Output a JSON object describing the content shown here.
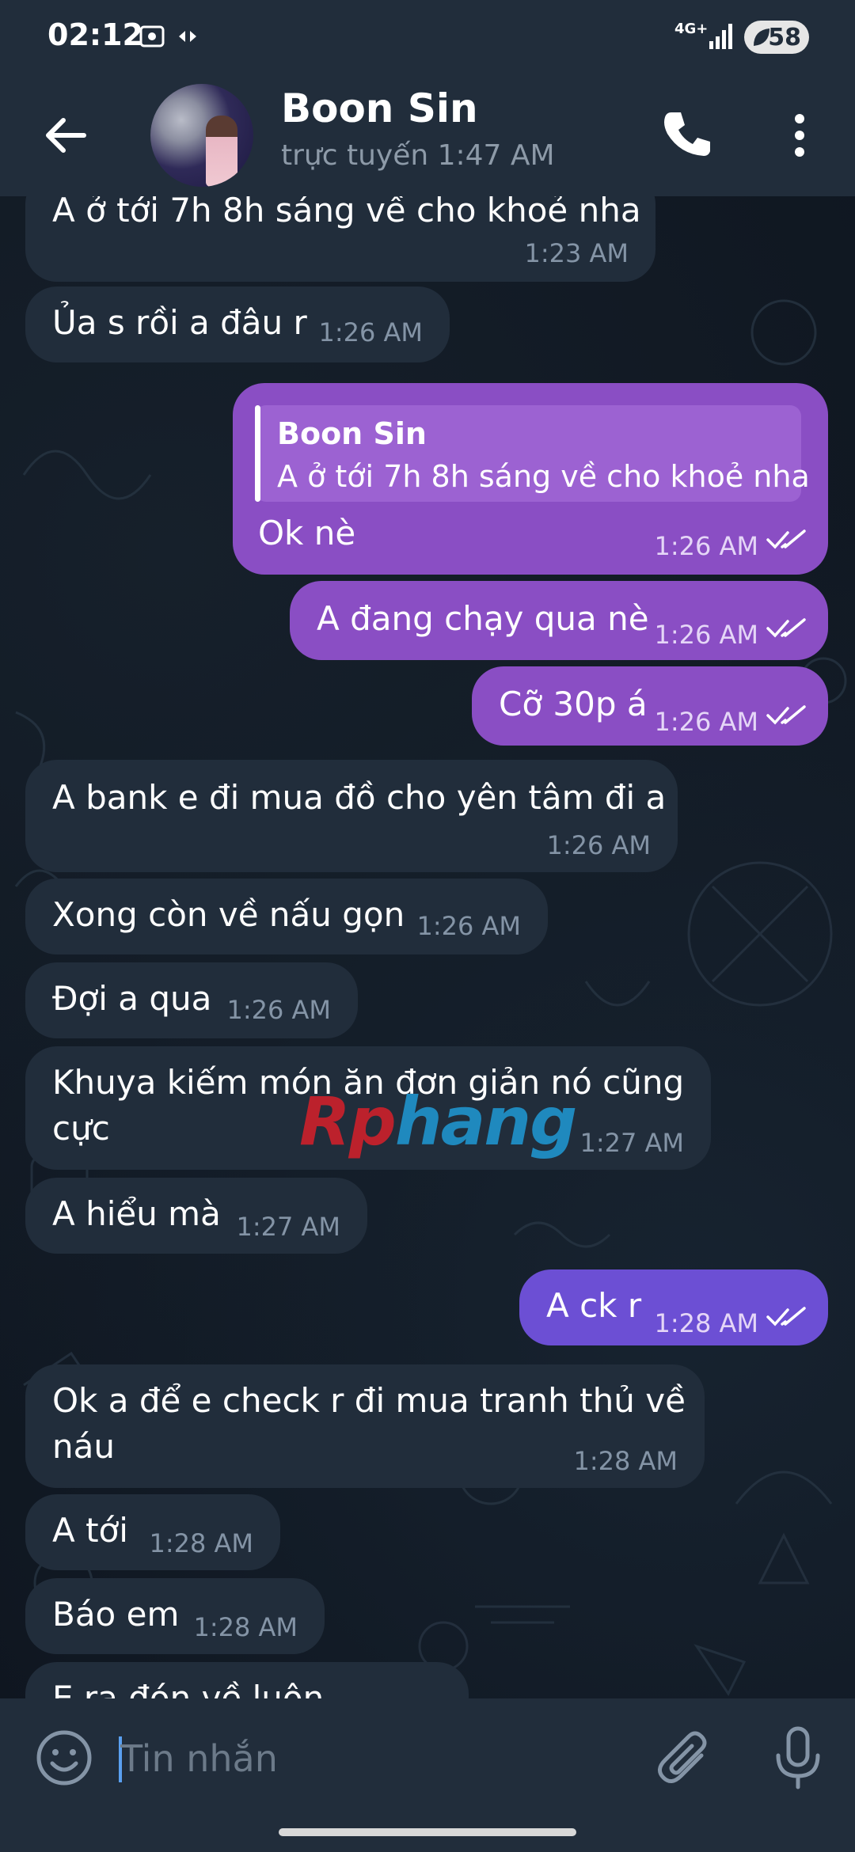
{
  "status_bar": {
    "time": "02:12",
    "network": "4G+",
    "battery": "58"
  },
  "header": {
    "contact_name": "Boon Sin",
    "contact_status": "trực tuyến 1:47 AM"
  },
  "messages": [
    {
      "direction": "in",
      "text": "A ở tới 7h 8h sáng về cho khoẻ nha",
      "time": "1:23 AM"
    },
    {
      "direction": "in",
      "text": "Ủa s rồi a đâu r",
      "time": "1:26 AM"
    },
    {
      "direction": "out",
      "reply_to_name": "Boon Sin",
      "reply_to_text": "A ở tới 7h 8h sáng về cho khoẻ nha",
      "text": "Ok nè",
      "time": "1:26 AM",
      "read": true
    },
    {
      "direction": "out",
      "text": "A đang chạy qua nè",
      "time": "1:26 AM",
      "read": true
    },
    {
      "direction": "out",
      "text": "Cỡ 30p á",
      "time": "1:26 AM",
      "read": true
    },
    {
      "direction": "in",
      "text": "A bank e đi mua đồ cho yên tâm đi a",
      "time": "1:26 AM"
    },
    {
      "direction": "in",
      "text": "Xong còn về nấu gọn",
      "time": "1:26 AM"
    },
    {
      "direction": "in",
      "text": "Đợi a qua",
      "time": "1:26 AM"
    },
    {
      "direction": "in",
      "text_line1": "Khuya kiếm món ăn đơn giản nó cũng",
      "text_line2": "cực",
      "time": "1:27 AM"
    },
    {
      "direction": "in",
      "text": "A hiểu mà",
      "time": "1:27 AM"
    },
    {
      "direction": "out",
      "text": "A ck r",
      "time": "1:28 AM",
      "read": true
    },
    {
      "direction": "in",
      "text_line1": "Ok a để e check r đi mua tranh thủ về",
      "text_line2": "náu",
      "time": "1:28 AM"
    },
    {
      "direction": "in",
      "text": "A tới",
      "time": "1:28 AM"
    },
    {
      "direction": "in",
      "text": "Báo em",
      "time": "1:28 AM"
    },
    {
      "direction": "in",
      "text": "E ra đón về luôn",
      "time": ""
    }
  ],
  "watermark": {
    "part1": "Rp",
    "part2": "hang"
  },
  "input": {
    "placeholder": "Tin nhắn"
  },
  "colors": {
    "header_bg": "#212d3b",
    "incoming_bubble": "#212d3b",
    "outgoing_bubble": "#8a4ec4",
    "outgoing_bubble_latest": "#6c4fd4"
  }
}
